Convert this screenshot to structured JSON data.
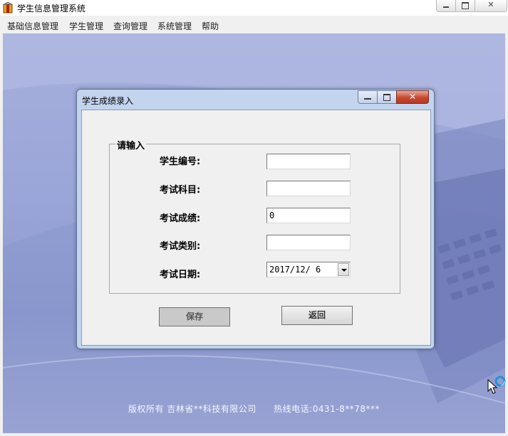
{
  "app": {
    "title": "学生信息管理系统"
  },
  "menu": [
    "基础信息管理",
    "学生管理",
    "查询管理",
    "系统管理",
    "帮助"
  ],
  "dialog": {
    "title": "学生成绩录入",
    "group_label": "请输入",
    "fields": [
      {
        "label": "学生编号:",
        "value": ""
      },
      {
        "label": "考试科目:",
        "value": ""
      },
      {
        "label": "考试成绩:",
        "value": "0"
      },
      {
        "label": "考试类别:",
        "value": ""
      },
      {
        "label": "考试日期:",
        "value": "2017/12/ 6"
      }
    ],
    "save_label": "保存",
    "back_label": "返回",
    "close_glyph": "✕"
  },
  "footer": {
    "copyright": "版权所有 吉林省**科技有限公司",
    "hotline": "热线电话:0431-8**78***"
  },
  "colors": {
    "dialog_frame": "#c3d4ef",
    "close_button": "#c9472f",
    "background": "#9aa6d8"
  }
}
